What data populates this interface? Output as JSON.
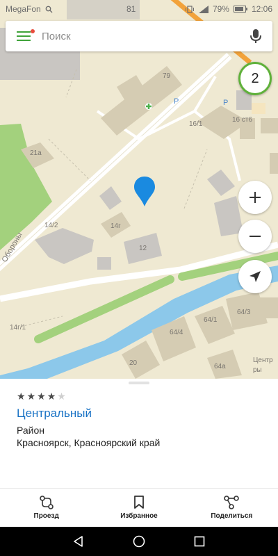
{
  "status_bar": {
    "carrier": "MegaFon",
    "notification_count": "81",
    "battery": "79%",
    "time": "12:06"
  },
  "search": {
    "placeholder": "Поиск"
  },
  "map": {
    "objects_count": "2",
    "labels": {
      "b79": "79",
      "b16_1": "16/1",
      "b16st6": "16 ст6",
      "b21a": "21а",
      "b14_2": "14/2",
      "b14g": "14г",
      "b12": "12",
      "b64_3": "64/3",
      "b64_1": "64/1",
      "b64_4": "64/4",
      "b14g_1": "14г/1",
      "b20": "20",
      "b64a": "64а",
      "street": "Обороны",
      "district_partial": "Центр\nры",
      "parking_1": "P",
      "parking_2": "P"
    }
  },
  "place": {
    "rating": 4,
    "max_rating": 5,
    "name": "Центральный",
    "type": "Район",
    "address": "Красноярск, Красноярский край"
  },
  "actions": {
    "route": "Проезд",
    "favorites": "Избранное",
    "share": "Поделиться"
  },
  "colors": {
    "accent_green": "#3fa33a",
    "link_blue": "#1a73c5",
    "pin_blue": "#1a8ae0",
    "water": "#8cc8ea",
    "park": "#a3d17d"
  },
  "icons": {
    "menu": "hamburger-icon",
    "mic": "microphone-icon",
    "zoom_in": "plus-icon",
    "zoom_out": "minus-icon",
    "locate": "navigation-arrow-icon",
    "route": "route-icon",
    "favorites": "bookmark-icon",
    "share": "share-icon"
  }
}
